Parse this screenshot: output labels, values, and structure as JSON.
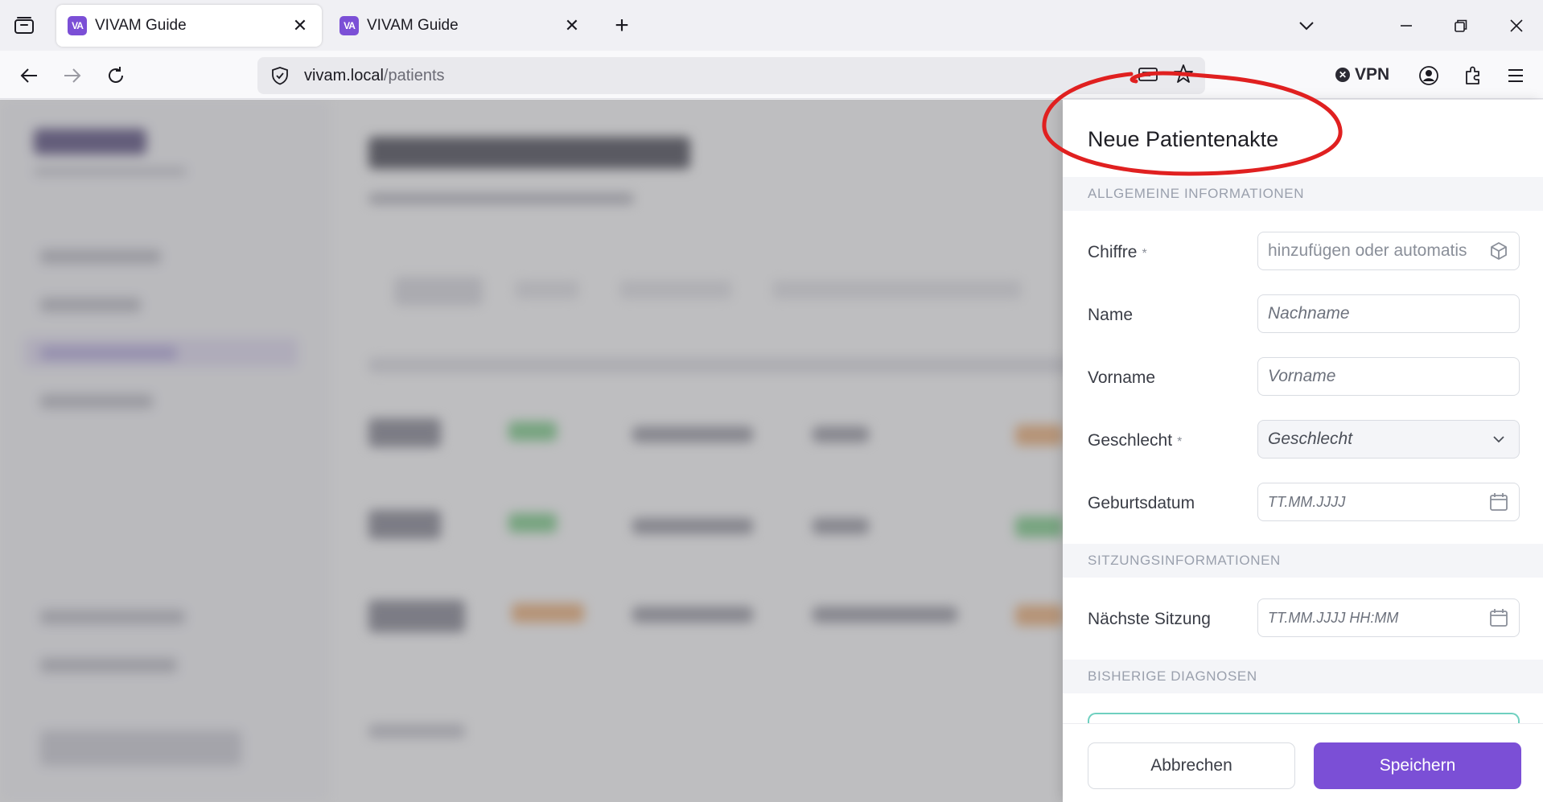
{
  "browser": {
    "tabs": [
      {
        "favicon": "VA",
        "title": "VIVAM Guide",
        "active": true
      },
      {
        "favicon": "VA",
        "title": "VIVAM Guide",
        "active": false
      }
    ],
    "url_host": "vivam.local",
    "url_path": "/patients",
    "vpn_label": "VPN"
  },
  "drawer": {
    "title": "Neue Patientenakte",
    "sections": {
      "general": "ALLGEMEINE INFORMATIONEN",
      "session": "SITZUNGSINFORMATIONEN",
      "diagnoses": "BISHERIGE DIAGNOSEN"
    },
    "fields": {
      "chiffre": {
        "label": "Chiffre",
        "required_mark": "*",
        "placeholder": "hinzufügen oder automatis"
      },
      "name": {
        "label": "Name",
        "placeholder": "Nachname"
      },
      "vorname": {
        "label": "Vorname",
        "placeholder": "Vorname"
      },
      "geschlecht": {
        "label": "Geschlecht",
        "required_mark": "*",
        "value": "Geschlecht"
      },
      "geburtsdatum": {
        "label": "Geburtsdatum",
        "placeholder": "TT.MM.JJJJ"
      },
      "naechste_sitzung": {
        "label": "Nächste Sitzung",
        "placeholder": "TT.MM.JJJJ HH:MM"
      }
    },
    "buttons": {
      "cancel": "Abbrechen",
      "save": "Speichern"
    }
  },
  "colors": {
    "accent": "#7b4fd6",
    "annotation": "#e02020",
    "diagnosis_border": "#6fd0c0"
  }
}
